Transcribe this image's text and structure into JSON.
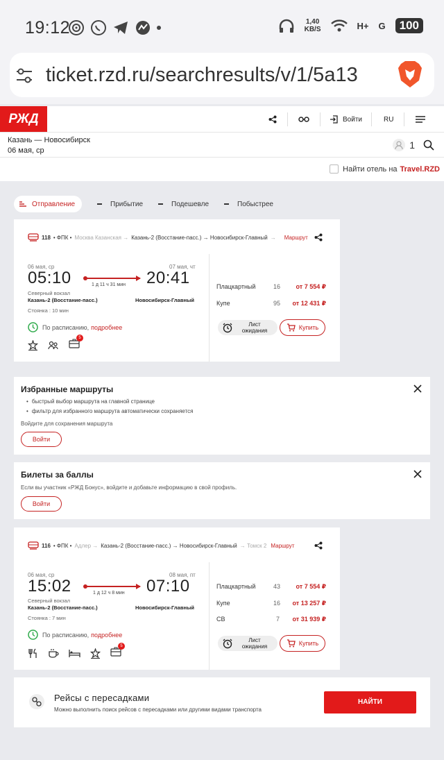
{
  "status_bar": {
    "time": "19:12",
    "speed_value": "1,40",
    "speed_unit": "KB/S",
    "net1": "H+",
    "net2": "G",
    "battery": "100"
  },
  "browser": {
    "url": "ticket.rzd.ru/searchresults/v/1/5a13"
  },
  "header": {
    "logo": "РЖД",
    "login": "Войти",
    "lang": "RU"
  },
  "route": {
    "title": "Казань — Новосибирск",
    "date": "06 мая, ср",
    "passengers": "1"
  },
  "hotel": {
    "prefix": "Найти отель на",
    "brand": "Travel.RZD"
  },
  "sort": {
    "active": "Отправление",
    "items": [
      "Прибытие",
      "Подешевле",
      "Побыстрее"
    ]
  },
  "trains": [
    {
      "number": "118",
      "carrier": "• ФПК •",
      "from_route": "Москва Казанская →",
      "segment": "Казань-2 (Восстание-пасс.) → Новосибирск-Главный",
      "to_route": "→",
      "route_link": "Маршрут",
      "dep_date": "06 мая, ср",
      "arr_date": "07 мая, чт",
      "dep_time": "05:10",
      "arr_time": "20:41",
      "duration": "1 д 11 ч 31 мин",
      "dep_terminal": "Северный вокзал",
      "dep_station": "Казань-2 (Восстание-пасс.)",
      "arr_station": "Новосибирск-Главный",
      "stop": "Стоянка : 10 мин",
      "schedule": "По расписанию,",
      "schedule_link": "подробнее",
      "badge": "5",
      "fares": [
        {
          "cls": "Плацкартный",
          "seats": "16",
          "price": "от 7 554 ₽"
        },
        {
          "cls": "Купе",
          "seats": "95",
          "price": "от 12 431 ₽"
        }
      ],
      "wait": "Лист ожидания",
      "buy": "Купить"
    },
    {
      "number": "116",
      "carrier": "• ФПК •",
      "from_route": "Адлер →",
      "segment": "Казань-2 (Восстание-пасс.) → Новосибирск-Главный",
      "to_route": "→ Томск 2",
      "route_link": "Маршрут",
      "dep_date": "06 мая, ср",
      "arr_date": "08 мая, пт",
      "dep_time": "15:02",
      "arr_time": "07:10",
      "duration": "1 д 12 ч 8 мин",
      "dep_terminal": "Северный вокзал",
      "dep_station": "Казань-2 (Восстание-пасс.)",
      "arr_station": "Новосибирск-Главный",
      "stop": "Стоянка : 7 мин",
      "schedule": "По расписанию,",
      "schedule_link": "подробнее",
      "badge": "5",
      "fares": [
        {
          "cls": "Плацкартный",
          "seats": "43",
          "price": "от 7 554 ₽"
        },
        {
          "cls": "Купе",
          "seats": "16",
          "price": "от 13 257 ₽"
        },
        {
          "cls": "СВ",
          "seats": "7",
          "price": "от 31 939 ₽"
        }
      ],
      "wait": "Лист ожидания",
      "buy": "Купить"
    }
  ],
  "favorites": {
    "title": "Избранные маршруты",
    "bullets": [
      "быстрый выбор маршрута на главной странице",
      "фильтр для избранного маршрута автоматически сохраняется"
    ],
    "note": "Войдите для сохранения маршрута",
    "button": "Войти"
  },
  "bonus": {
    "title": "Билеты за баллы",
    "note": "Если вы участник «РЖД Бонус», войдите и добавьте информацию в свой профиль.",
    "button": "Войти"
  },
  "transfer": {
    "title": "Рейсы с пересадками",
    "text": "Можно выполнить поиск рейсов с пересадками или другими видами транспорта",
    "button": "НАЙТИ"
  },
  "colors": {
    "brand": "#e21a1a",
    "accent": "#c52222"
  }
}
